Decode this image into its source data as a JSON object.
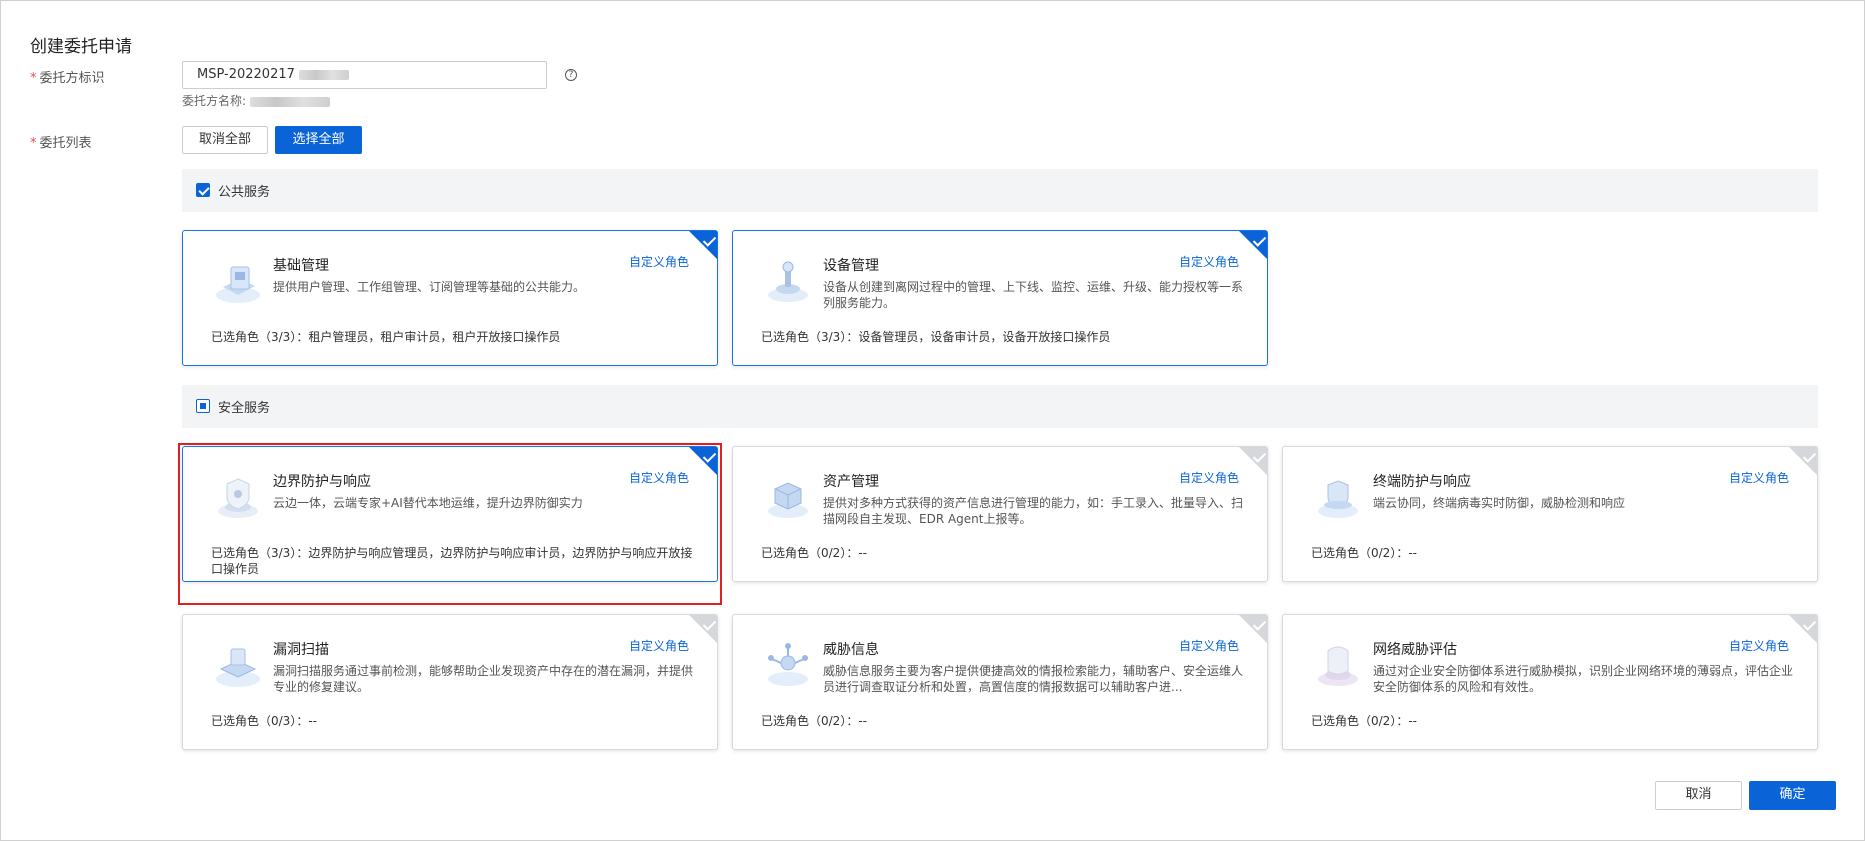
{
  "page_title": "创建委托申请",
  "form": {
    "delegator_label": "委托方标识",
    "delegator_value": "MSP-20220217",
    "delegator_name_label": "委托方名称:",
    "delegation_list_label": "委托列表",
    "deselect_all": "取消全部",
    "select_all": "选择全部"
  },
  "groups": [
    {
      "label": "公共服务",
      "state": "checked",
      "cards": [
        {
          "title": "基础管理",
          "desc": "提供用户管理、工作组管理、订阅管理等基础的公共能力。",
          "link": "自定义角色",
          "roles": "已选角色（3/3）：租户管理员，租户审计员，租户开放接口操作员",
          "selected": true,
          "icon": "basic-management-icon"
        },
        {
          "title": "设备管理",
          "desc": "设备从创建到离网过程中的管理、上下线、监控、运维、升级、能力授权等一系列服务能力。",
          "link": "自定义角色",
          "roles": "已选角色（3/3）：设备管理员，设备审计员，设备开放接口操作员",
          "selected": true,
          "icon": "device-management-icon"
        }
      ]
    },
    {
      "label": "安全服务",
      "state": "partial",
      "cards": [
        {
          "title": "边界防护与响应",
          "desc": "云边一体，云端专家+AI替代本地运维，提升边界防御实力",
          "link": "自定义角色",
          "roles": "已选角色（3/3）：边界防护与响应管理员，边界防护与响应审计员，边界防护与响应开放接口操作员",
          "selected": true,
          "icon": "boundary-protection-icon"
        },
        {
          "title": "资产管理",
          "desc": "提供对多种方式获得的资产信息进行管理的能力，如：手工录入、批量导入、扫描网段自主发现、EDR Agent上报等。",
          "link": "自定义角色",
          "roles": "已选角色（0/2）：--",
          "selected": false,
          "icon": "asset-management-icon"
        },
        {
          "title": "终端防护与响应",
          "desc": "端云协同，终端病毒实时防御，威胁检测和响应",
          "link": "自定义角色",
          "roles": "已选角色（0/2）：--",
          "selected": false,
          "icon": "endpoint-protection-icon"
        },
        {
          "title": "漏洞扫描",
          "desc": "漏洞扫描服务通过事前检测，能够帮助企业发现资产中存在的潜在漏洞，并提供专业的修复建议。",
          "link": "自定义角色",
          "roles": "已选角色（0/3）：--",
          "selected": false,
          "icon": "vulnerability-scan-icon"
        },
        {
          "title": "威胁信息",
          "desc": "威胁信息服务主要为客户提供便捷高效的情报检索能力，辅助客户、安全运维人员进行调查取证分析和处置，高置信度的情报数据可以辅助客户进...",
          "link": "自定义角色",
          "roles": "已选角色（0/2）：--",
          "selected": false,
          "icon": "threat-intel-icon"
        },
        {
          "title": "网络威胁评估",
          "desc": "通过对企业安全防御体系进行威胁模拟，识别企业网络环境的薄弱点，评估企业安全防御体系的风险和有效性。",
          "link": "自定义角色",
          "roles": "已选角色（0/2）：--",
          "selected": false,
          "icon": "network-threat-assessment-icon"
        }
      ]
    }
  ],
  "footer": {
    "cancel": "取消",
    "confirm": "确定"
  },
  "colors": {
    "primary": "#0a64d8",
    "highlight": "#e02020"
  }
}
